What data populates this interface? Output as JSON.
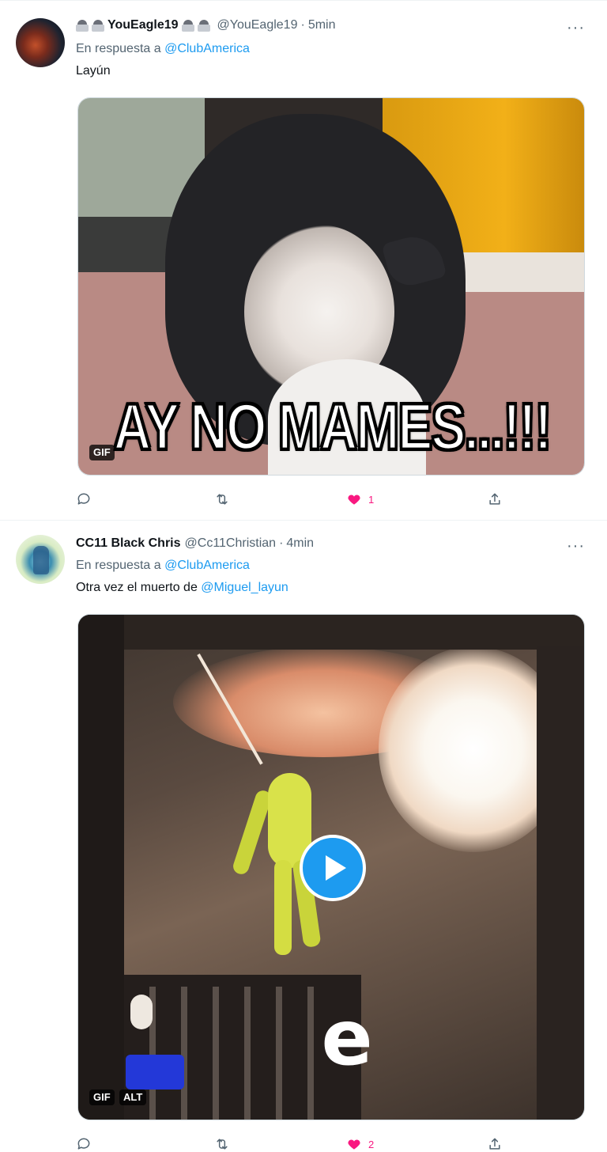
{
  "tweets": [
    {
      "display_name": "YouEagle19",
      "handle": "@YouEagle19",
      "time": "5min",
      "reply_prefix": "En respuesta a",
      "reply_mention": "@ClubAmerica",
      "text": "Layún",
      "media": {
        "type": "gif",
        "badge": "GIF",
        "overlay_text": "AY NO MAMES...!!!"
      },
      "actions": {
        "reply_count": "",
        "retweet_count": "",
        "like_count": "1",
        "liked": true
      }
    },
    {
      "display_name": "CC11 Black Chris",
      "handle": "@Cc11Christian",
      "time": "4min",
      "reply_prefix": "En respuesta a",
      "reply_mention": "@ClubAmerica",
      "text_prefix": "Otra vez el muerto de",
      "text_mention": "@Miguel_layun",
      "media": {
        "type": "gif",
        "badge": "GIF",
        "alt_badge": "ALT",
        "overlay_letter": "e"
      },
      "actions": {
        "reply_count": "",
        "retweet_count": "",
        "like_count": "2",
        "liked": true
      }
    }
  ],
  "ui": {
    "more_icon": "···",
    "separator": "·"
  },
  "colors": {
    "accent": "#1d9bf0",
    "like": "#f91880",
    "secondary_text": "#536471"
  }
}
